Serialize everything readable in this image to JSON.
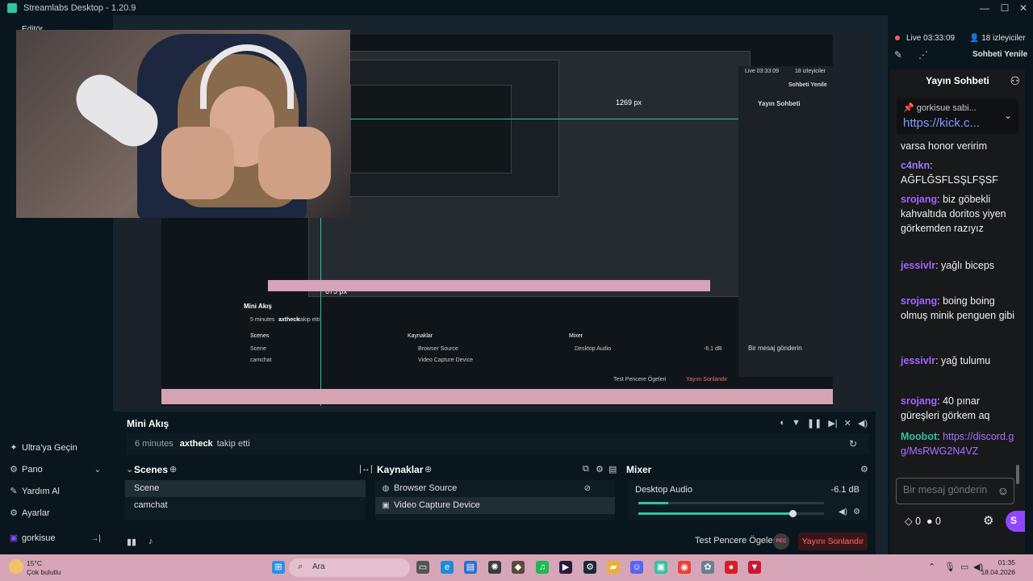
{
  "window": {
    "title": "Streamlabs Desktop - 1.20.9",
    "minimize": "—",
    "maximize": "☐",
    "close": "✕"
  },
  "sidebar": {
    "top_label": "Editör",
    "items": [
      {
        "label": "Ultra'ya Geçin",
        "icon": "sparkle-icon"
      },
      {
        "label": "Pano",
        "icon": "dashboard-icon"
      },
      {
        "label": "Yardım Al",
        "icon": "help-icon"
      },
      {
        "label": "Ayarlar",
        "icon": "gear-icon"
      },
      {
        "label": "gorkisue",
        "icon": "twitch-icon"
      }
    ],
    "logout_glyph": "→|"
  },
  "preview": {
    "nested_labels": {
      "mini_akis": "Mini Akış",
      "scenes": "Scenes",
      "kaynaklar": "Kaynaklar",
      "mixer": "Mixer",
      "scene": "Scene",
      "camchat": "camchat",
      "browser_source": "Browser Source",
      "video_capture": "Video Capture Device",
      "desktop_audio": "Desktop Audio",
      "db": "-6.1 dB",
      "test": "Test Pencere Ögeleri",
      "end": "Yayını Sonlandır",
      "follow_time": "5 minutes",
      "follow_user": "axtheck",
      "follow_text": "takip etti",
      "dims_1": "1269 px",
      "dims_2": "675 px",
      "live": "Live 03:33:09",
      "viewers": "18 izleyiciler",
      "refresh": "Sohbeti Yenile",
      "chat_title": "Yayın Sohbeti",
      "placeholder": "Bir mesaj gönderin"
    }
  },
  "chat": {
    "live_status": "Live",
    "live_time": "03:33:09",
    "viewers": "18 izleyiciler",
    "refresh_label": "Sohbeti Yenile",
    "title": "Yayın Sohbeti",
    "pinned_user": "gorkisue sabi...",
    "pinned_link": "https://kick.c...",
    "partial_line": "varsa honor veririm",
    "messages": [
      {
        "user": "c4nkn",
        "text": "AĞFLĞSFLSŞLFŞSF",
        "color": "#9d76ff"
      },
      {
        "user": "srojang",
        "text": "biz göbekli kahvaltıda doritos yiyen görkemden razıyız",
        "color": "#a463ff"
      },
      {
        "user": "jessivlr",
        "text": "yağlı biceps",
        "color": "#a463ff"
      },
      {
        "user": "srojang",
        "text": "boing boing olmuş minik penguen gibi",
        "color": "#a463ff"
      },
      {
        "user": "jessivlr",
        "text": "yağ tulumu",
        "color": "#a463ff"
      },
      {
        "user": "srojang",
        "text": "40 pınar güreşleri görkem aq",
        "color": "#a463ff"
      },
      {
        "user": "Moobot",
        "text": "https://discord.gg/MsRWG2N4VZ",
        "color": "#31c3a2"
      }
    ],
    "input_placeholder": "Bir mesaj gönderin",
    "points_a": "0",
    "points_b": "0",
    "send_label": "S"
  },
  "dock": {
    "mini_title": "Mini Akış",
    "activity": {
      "time": "6 minutes",
      "user": "axtheck",
      "text": "takip etti"
    },
    "scenes_title": "Scenes",
    "scenes": [
      {
        "name": "Scene",
        "selected": true
      },
      {
        "name": "camchat",
        "selected": false
      }
    ],
    "sources_title": "Kaynaklar",
    "sources": [
      {
        "name": "Browser Source",
        "icon": "globe-icon",
        "selected": false
      },
      {
        "name": "Video Capture Device",
        "icon": "camera-icon",
        "selected": true
      }
    ],
    "mixer_title": "Mixer",
    "mixer": {
      "name": "Desktop Audio",
      "db": "-6.1 dB",
      "volume": 0.83,
      "level": 0.16
    },
    "test_label": "Test Pencere Ögeleri",
    "rec_label": "REC",
    "end_label": "Yayını Sonlandır"
  },
  "taskbar": {
    "weather_temp": "15°C",
    "weather_desc": "Çok bulutlu",
    "search_placeholder": "Ara",
    "time": "01:35",
    "date": "18.04.2026"
  },
  "colors": {
    "accent": "#31c3a2",
    "danger": "#ff5a5f",
    "twitch": "#9147ff",
    "taskbar": "#d6a6b8"
  }
}
